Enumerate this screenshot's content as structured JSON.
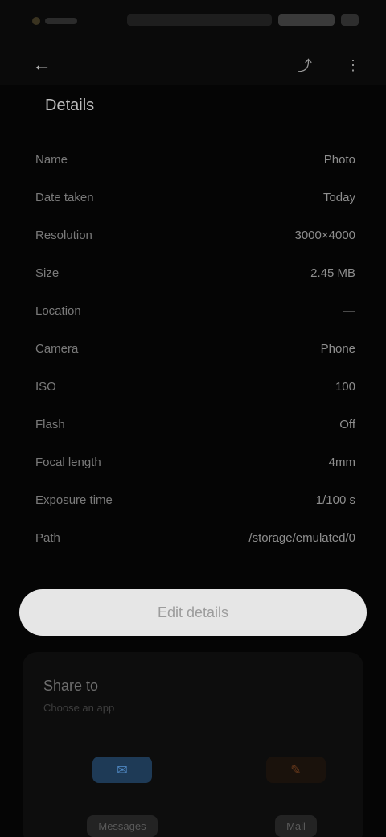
{
  "status_bar": {
    "icons": [
      "signal-icon",
      "wifi-icon",
      "battery-icon"
    ]
  },
  "toolbar": {
    "back_symbol": "←",
    "share_symbol": "⤴",
    "more_symbol": "⋮"
  },
  "section": {
    "title": "Details"
  },
  "info": [
    {
      "key": "Name",
      "value": "Photo"
    },
    {
      "key": "Date taken",
      "value": "Today"
    },
    {
      "key": "Resolution",
      "value": "3000×4000"
    },
    {
      "key": "Size",
      "value": "2.45 MB"
    },
    {
      "key": "Location",
      "value": "—"
    },
    {
      "key": "Camera",
      "value": "Phone"
    },
    {
      "key": "ISO",
      "value": "100"
    },
    {
      "key": "Flash",
      "value": "Off"
    },
    {
      "key": "Focal length",
      "value": "4mm"
    },
    {
      "key": "Exposure time",
      "value": "1/100 s"
    },
    {
      "key": "Path",
      "value": "/storage/emulated/0"
    }
  ],
  "primary_button": {
    "label": "Edit details"
  },
  "footer": {
    "title": "Share to",
    "subtitle": "Choose an app",
    "options": [
      {
        "label": "Messages",
        "icon": "message-icon",
        "glyph": "✉"
      },
      {
        "label": "Mail",
        "icon": "mail-icon",
        "glyph": "✎"
      }
    ]
  },
  "colors": {
    "background": "#050505",
    "button": "#e6e6e6",
    "accent_blue": "#4e86c0",
    "accent_orange": "#6a3a1c"
  }
}
